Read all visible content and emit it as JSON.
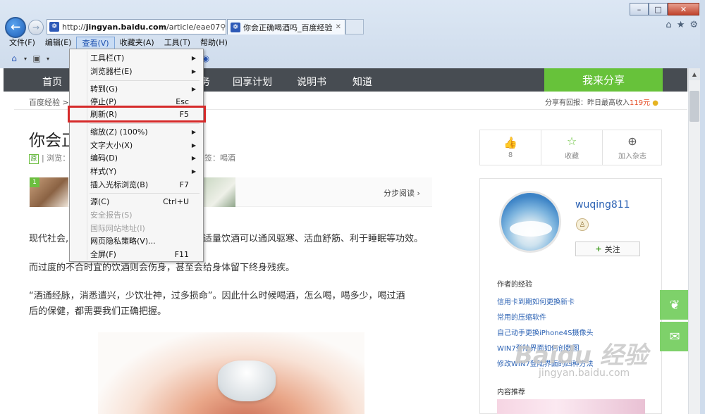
{
  "browser": {
    "address_prefix": "http://",
    "address_domain": "jingyan.baidu.com",
    "address_rest": "/article/eae07",
    "tab_title": "你会正确喝酒吗_百度经验",
    "tab_close": "✕",
    "window_buttons": [
      "–",
      "□",
      "✕"
    ],
    "nav_back_glyph": "←",
    "nav_fwd_glyph": "→",
    "right_icons": [
      "⌂",
      "★",
      "⚙"
    ]
  },
  "menubar": {
    "items": [
      "文件(F)",
      "编辑(E)",
      "查看(V)",
      "收藏夹(A)",
      "工具(T)",
      "帮助(H)"
    ],
    "active_index": 2
  },
  "cmdbar": {
    "partial_label": "D)"
  },
  "view_menu": {
    "items": [
      {
        "label": "工具栏(T)",
        "shortcut": "",
        "submenu": true,
        "disabled": false
      },
      {
        "label": "浏览器栏(E)",
        "shortcut": "",
        "submenu": true,
        "disabled": false
      },
      {
        "label": "转到(G)",
        "shortcut": "",
        "submenu": true,
        "disabled": false
      },
      {
        "label": "停止(P)",
        "shortcut": "Esc",
        "submenu": false,
        "disabled": false
      },
      {
        "label": "刷新(R)",
        "shortcut": "F5",
        "submenu": false,
        "disabled": false
      },
      {
        "label": "缩放(Z) (100%)",
        "shortcut": "",
        "submenu": true,
        "disabled": false
      },
      {
        "label": "文字大小(X)",
        "shortcut": "",
        "submenu": true,
        "disabled": false
      },
      {
        "label": "编码(D)",
        "shortcut": "",
        "submenu": true,
        "disabled": false
      },
      {
        "label": "样式(Y)",
        "shortcut": "",
        "submenu": true,
        "disabled": false
      },
      {
        "label": "插入光标浏览(B)",
        "shortcut": "F7",
        "submenu": false,
        "disabled": false
      },
      {
        "label": "源(C)",
        "shortcut": "Ctrl+U",
        "submenu": false,
        "disabled": false
      },
      {
        "label": "安全报告(S)",
        "shortcut": "",
        "submenu": false,
        "disabled": true
      },
      {
        "label": "国际网站地址(I)",
        "shortcut": "",
        "submenu": false,
        "disabled": true
      },
      {
        "label": "网页隐私策略(V)...",
        "shortcut": "",
        "submenu": false,
        "disabled": false
      },
      {
        "label": "全屏(F)",
        "shortcut": "F11",
        "submenu": false,
        "disabled": false
      }
    ],
    "highlighted": "刷新(R)",
    "highlight_color": "#d62a2a"
  },
  "site": {
    "nav": [
      "首页",
      "务",
      "回享计划",
      "说明书",
      "知道"
    ],
    "share_button": "我来分享",
    "breadcrumb": "百度经验 >",
    "share_tip_prefix": "分享有回报：昨日最高收入",
    "share_tip_amount": "119元",
    "accent": "#67c23a"
  },
  "article": {
    "title": "你会正",
    "meta_badge": "原",
    "meta_text": "| 浏览：",
    "meta_tag": "签：喝酒",
    "step_number": "1",
    "step_link": "分步阅读 ›",
    "paragraphs": [
      "现代社会,",
      "适量饮酒可以通风驱寒、活血舒筋、利于睡眠等功效。",
      "而过度的不合时宜的饮酒则会伤身，甚至会给身体留下终身残疾。",
      "“酒通经脉，消悉遣兴，少饮壮神，过多损命”。因此什么时候喝酒，怎么喝，喝多少，喝过酒",
      "后的保健，都需要我们正确把握。"
    ]
  },
  "sidebar": {
    "actions": [
      {
        "icon": "👍",
        "label": "8"
      },
      {
        "icon": "☆",
        "label": "收藏"
      },
      {
        "icon": "⊕",
        "label": "加入杂志"
      }
    ],
    "author": "wuqing811",
    "badge": "♙",
    "follow": "关注",
    "follow_plus": "+",
    "experience_title": "作者的经验",
    "experience_links": [
      "信用卡到期如何更换新卡",
      "常用的压缩软件",
      "自己动手更换iPhone4S摄像头",
      "WIN7登陆界面如何创数图",
      "修改WIN7登陆界面的四种方法"
    ],
    "recommend_title": "内容推荐"
  },
  "float_buttons": [
    "❦",
    "✉"
  ],
  "watermark": {
    "text": "Baidu 经验",
    "url": "jingyan.baidu.com"
  }
}
